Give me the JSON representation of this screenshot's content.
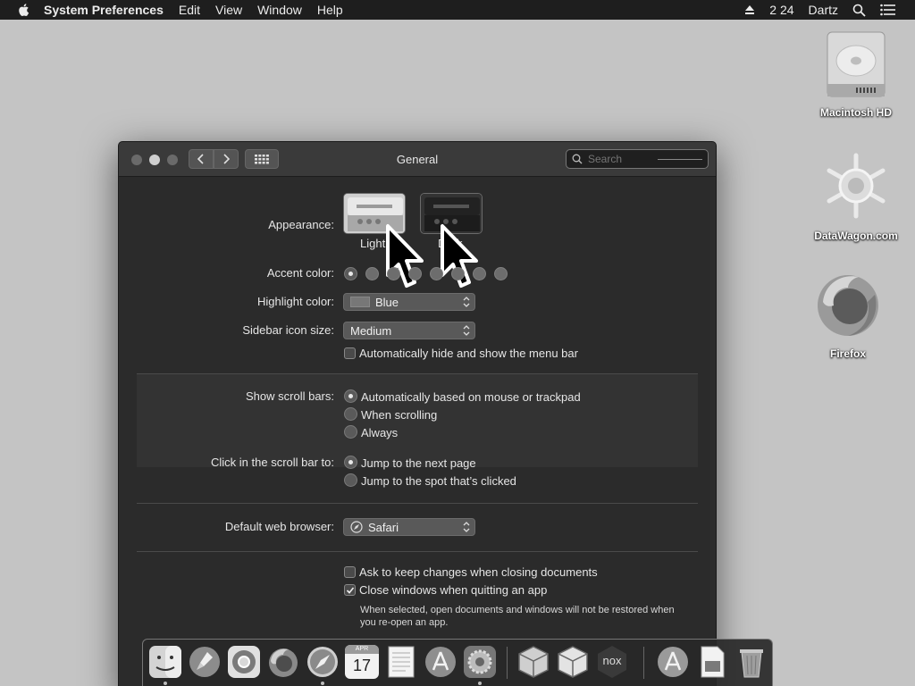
{
  "menubar": {
    "app_name": "System Preferences",
    "menus": [
      "Edit",
      "View",
      "Window",
      "Help"
    ],
    "clock": "2 24",
    "user": "Dartz"
  },
  "desktop": {
    "icons": [
      {
        "label": "Macintosh HD"
      },
      {
        "label": "DataWagon.com"
      },
      {
        "label": "Firefox"
      }
    ]
  },
  "window": {
    "title": "General",
    "search_placeholder": "Search",
    "appearance": {
      "label": "Appearance:",
      "options": [
        "Light",
        "Dark"
      ],
      "selected": "Light"
    },
    "accent": {
      "label": "Accent color:",
      "swatch_count": 8,
      "selected_index": 0
    },
    "highlight": {
      "label": "Highlight color:",
      "value": "Blue"
    },
    "sidebar_icon_size": {
      "label": "Sidebar icon size:",
      "value": "Medium"
    },
    "autohide_menubar": {
      "label": "Automatically hide and show the menu bar",
      "checked": false
    },
    "scroll_bars": {
      "label": "Show scroll bars:",
      "options": [
        "Automatically based on mouse or trackpad",
        "When scrolling",
        "Always"
      ],
      "selected_index": 0
    },
    "click_scroll": {
      "label": "Click in the scroll bar to:",
      "options": [
        "Jump to the next page",
        "Jump to the spot that’s clicked"
      ],
      "selected_index": 0
    },
    "browser": {
      "label": "Default web browser:",
      "value": "Safari"
    },
    "ask_keep_changes": {
      "label": "Ask to keep changes when closing documents",
      "checked": false
    },
    "close_windows": {
      "label": "Close windows when quitting an app",
      "checked": true
    },
    "close_windows_note": "When selected, open documents and windows will not be restored when you re-open an app."
  },
  "dock": {
    "items": [
      "finder-icon",
      "launchpad-icon",
      "chrome-icon",
      "firefox-icon",
      "safari-icon",
      "calendar-icon",
      "textedit-icon",
      "app-store-icon",
      "system-preferences-icon",
      "virtualbox-icon",
      "virtualbox-vm-icon",
      "nox-icon",
      "downloads-icon",
      "document-icon",
      "trash-icon"
    ],
    "calendar_month": "APR",
    "calendar_day": "17",
    "nox_label": "nox"
  }
}
